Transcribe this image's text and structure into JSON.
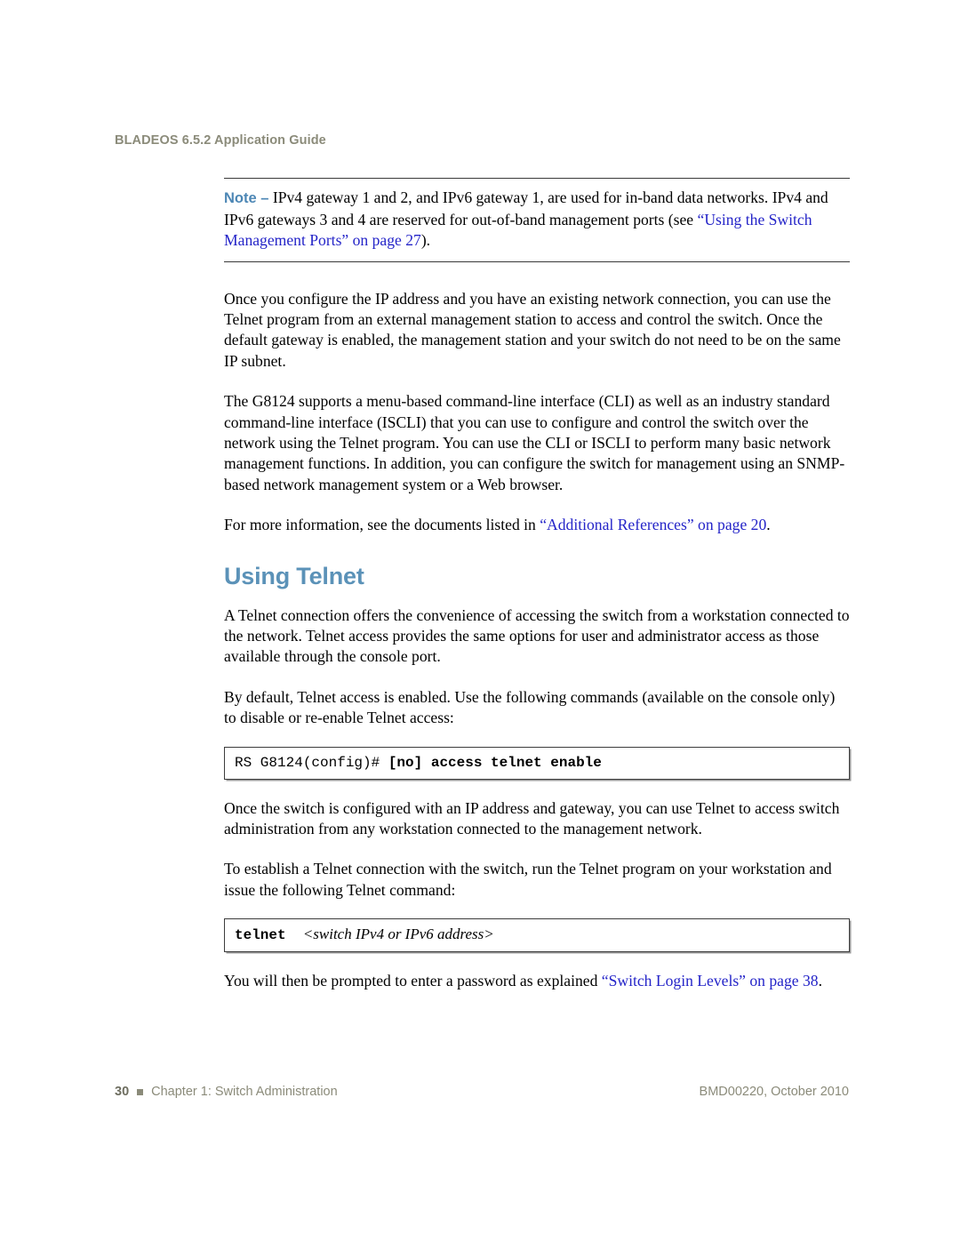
{
  "header": {
    "running_title": "BLADEOS 6.5.2 Application Guide"
  },
  "note": {
    "label": "Note –",
    "text_part1": " IPv4 gateway 1 and 2, and IPv6 gateway 1, are used for in-band data networks. IPv4 and IPv6 gateways 3 and 4 are reserved for out-of-band management ports (see ",
    "link": "“Using the Switch Management Ports” on page 27",
    "text_part2": ")."
  },
  "paragraphs": {
    "p1": "Once you configure the IP address and you have an existing network connection, you can use the Telnet program from an external management station to access and control the switch. Once the default gateway is enabled, the management station and your switch do not need to be on the same IP subnet.",
    "p2": "The G8124 supports a menu-based command-line interface (CLI) as well as an industry standard command-line interface (ISCLI) that you can use to configure and control the switch over the network using the Telnet program. You can use the CLI or ISCLI to perform many basic network management functions. In addition, you can configure the switch for management using an SNMP-based network management system or a Web browser.",
    "p3_prefix": "For more information, see the documents listed in ",
    "p3_link": "“Additional References” on page 20",
    "p3_suffix": ".",
    "p4": "A Telnet connection offers the convenience of accessing the switch from a workstation connected to the network. Telnet access provides the same options for user and administrator access as those available through the console port.",
    "p5": "By default, Telnet access is enabled. Use the following commands (available on the console only) to disable or re-enable Telnet access:",
    "p6": "Once the switch is configured with an IP address and gateway, you can use Telnet to access switch administration from any workstation connected to the management network.",
    "p7": "To establish a Telnet connection with the switch, run the Telnet program on your workstation and issue the following Telnet command:",
    "p8_prefix": "You will then be prompted to enter a password as explained ",
    "p8_link": "“Switch Login Levels” on page 38",
    "p8_suffix": "."
  },
  "section": {
    "title": "Using Telnet"
  },
  "code_blocks": {
    "telnet_enable": {
      "prompt": "RS G8124(config)# ",
      "command": "[no] access telnet enable"
    },
    "telnet_connect": {
      "command": "telnet",
      "argument": "<switch IPv4 or IPv6 address>"
    }
  },
  "footer": {
    "page_number": "30",
    "chapter": "Chapter 1: Switch Administration",
    "doc_id": "BMD00220, October 2010"
  },
  "colors": {
    "heading_blue": "#5b92b8",
    "link_blue": "#2424c8",
    "note_label_blue": "#4d87b5",
    "header_footer_gray": "#8b8b7a"
  }
}
